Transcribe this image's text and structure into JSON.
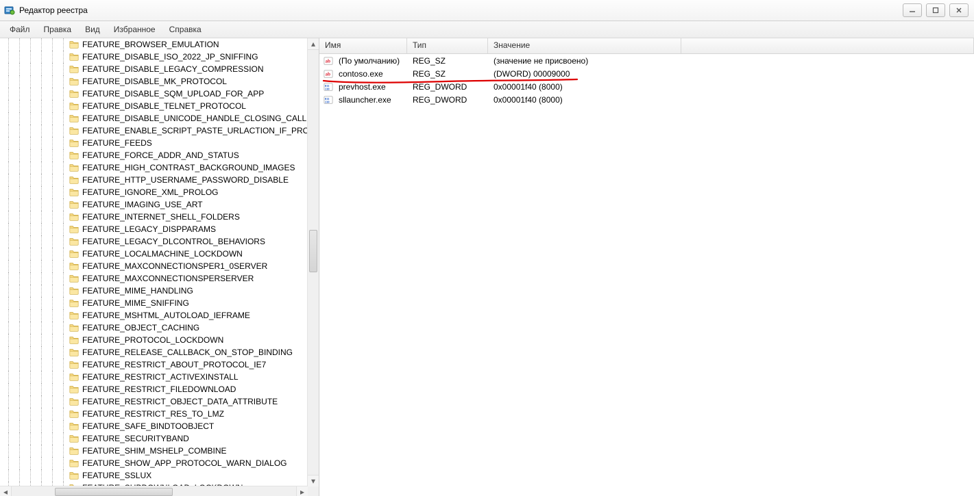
{
  "window": {
    "title": "Редактор реестра"
  },
  "menu": {
    "items": [
      "Файл",
      "Правка",
      "Вид",
      "Избранное",
      "Справка"
    ]
  },
  "tree": {
    "items": [
      "FEATURE_BROWSER_EMULATION",
      "FEATURE_DISABLE_ISO_2022_JP_SNIFFING",
      "FEATURE_DISABLE_LEGACY_COMPRESSION",
      "FEATURE_DISABLE_MK_PROTOCOL",
      "FEATURE_DISABLE_SQM_UPLOAD_FOR_APP",
      "FEATURE_DISABLE_TELNET_PROTOCOL",
      "FEATURE_DISABLE_UNICODE_HANDLE_CLOSING_CALLBACK",
      "FEATURE_ENABLE_SCRIPT_PASTE_URLACTION_IF_PROMPT",
      "FEATURE_FEEDS",
      "FEATURE_FORCE_ADDR_AND_STATUS",
      "FEATURE_HIGH_CONTRAST_BACKGROUND_IMAGES",
      "FEATURE_HTTP_USERNAME_PASSWORD_DISABLE",
      "FEATURE_IGNORE_XML_PROLOG",
      "FEATURE_IMAGING_USE_ART",
      "FEATURE_INTERNET_SHELL_FOLDERS",
      "FEATURE_LEGACY_DISPPARAMS",
      "FEATURE_LEGACY_DLCONTROL_BEHAVIORS",
      "FEATURE_LOCALMACHINE_LOCKDOWN",
      "FEATURE_MAXCONNECTIONSPER1_0SERVER",
      "FEATURE_MAXCONNECTIONSPERSERVER",
      "FEATURE_MIME_HANDLING",
      "FEATURE_MIME_SNIFFING",
      "FEATURE_MSHTML_AUTOLOAD_IEFRAME",
      "FEATURE_OBJECT_CACHING",
      "FEATURE_PROTOCOL_LOCKDOWN",
      "FEATURE_RELEASE_CALLBACK_ON_STOP_BINDING",
      "FEATURE_RESTRICT_ABOUT_PROTOCOL_IE7",
      "FEATURE_RESTRICT_ACTIVEXINSTALL",
      "FEATURE_RESTRICT_FILEDOWNLOAD",
      "FEATURE_RESTRICT_OBJECT_DATA_ATTRIBUTE",
      "FEATURE_RESTRICT_RES_TO_LMZ",
      "FEATURE_SAFE_BINDTOOBJECT",
      "FEATURE_SECURITYBAND",
      "FEATURE_SHIM_MSHELP_COMBINE",
      "FEATURE_SHOW_APP_PROTOCOL_WARN_DIALOG",
      "FEATURE_SSLUX",
      "FEATURE_SUBDOWNLOAD_LOCKDOWN"
    ]
  },
  "list": {
    "columns": {
      "name": "Имя",
      "type": "Тип",
      "value": "Значение"
    },
    "rows": [
      {
        "icon": "sz",
        "name": "(По умолчанию)",
        "type": "REG_SZ",
        "value": "(значение не присвоено)"
      },
      {
        "icon": "sz",
        "name": "contoso.exe",
        "type": "REG_SZ",
        "value": "(DWORD) 00009000"
      },
      {
        "icon": "dword",
        "name": "prevhost.exe",
        "type": "REG_DWORD",
        "value": "0x00001f40 (8000)"
      },
      {
        "icon": "dword",
        "name": "sllauncher.exe",
        "type": "REG_DWORD",
        "value": "0x00001f40 (8000)"
      }
    ]
  }
}
